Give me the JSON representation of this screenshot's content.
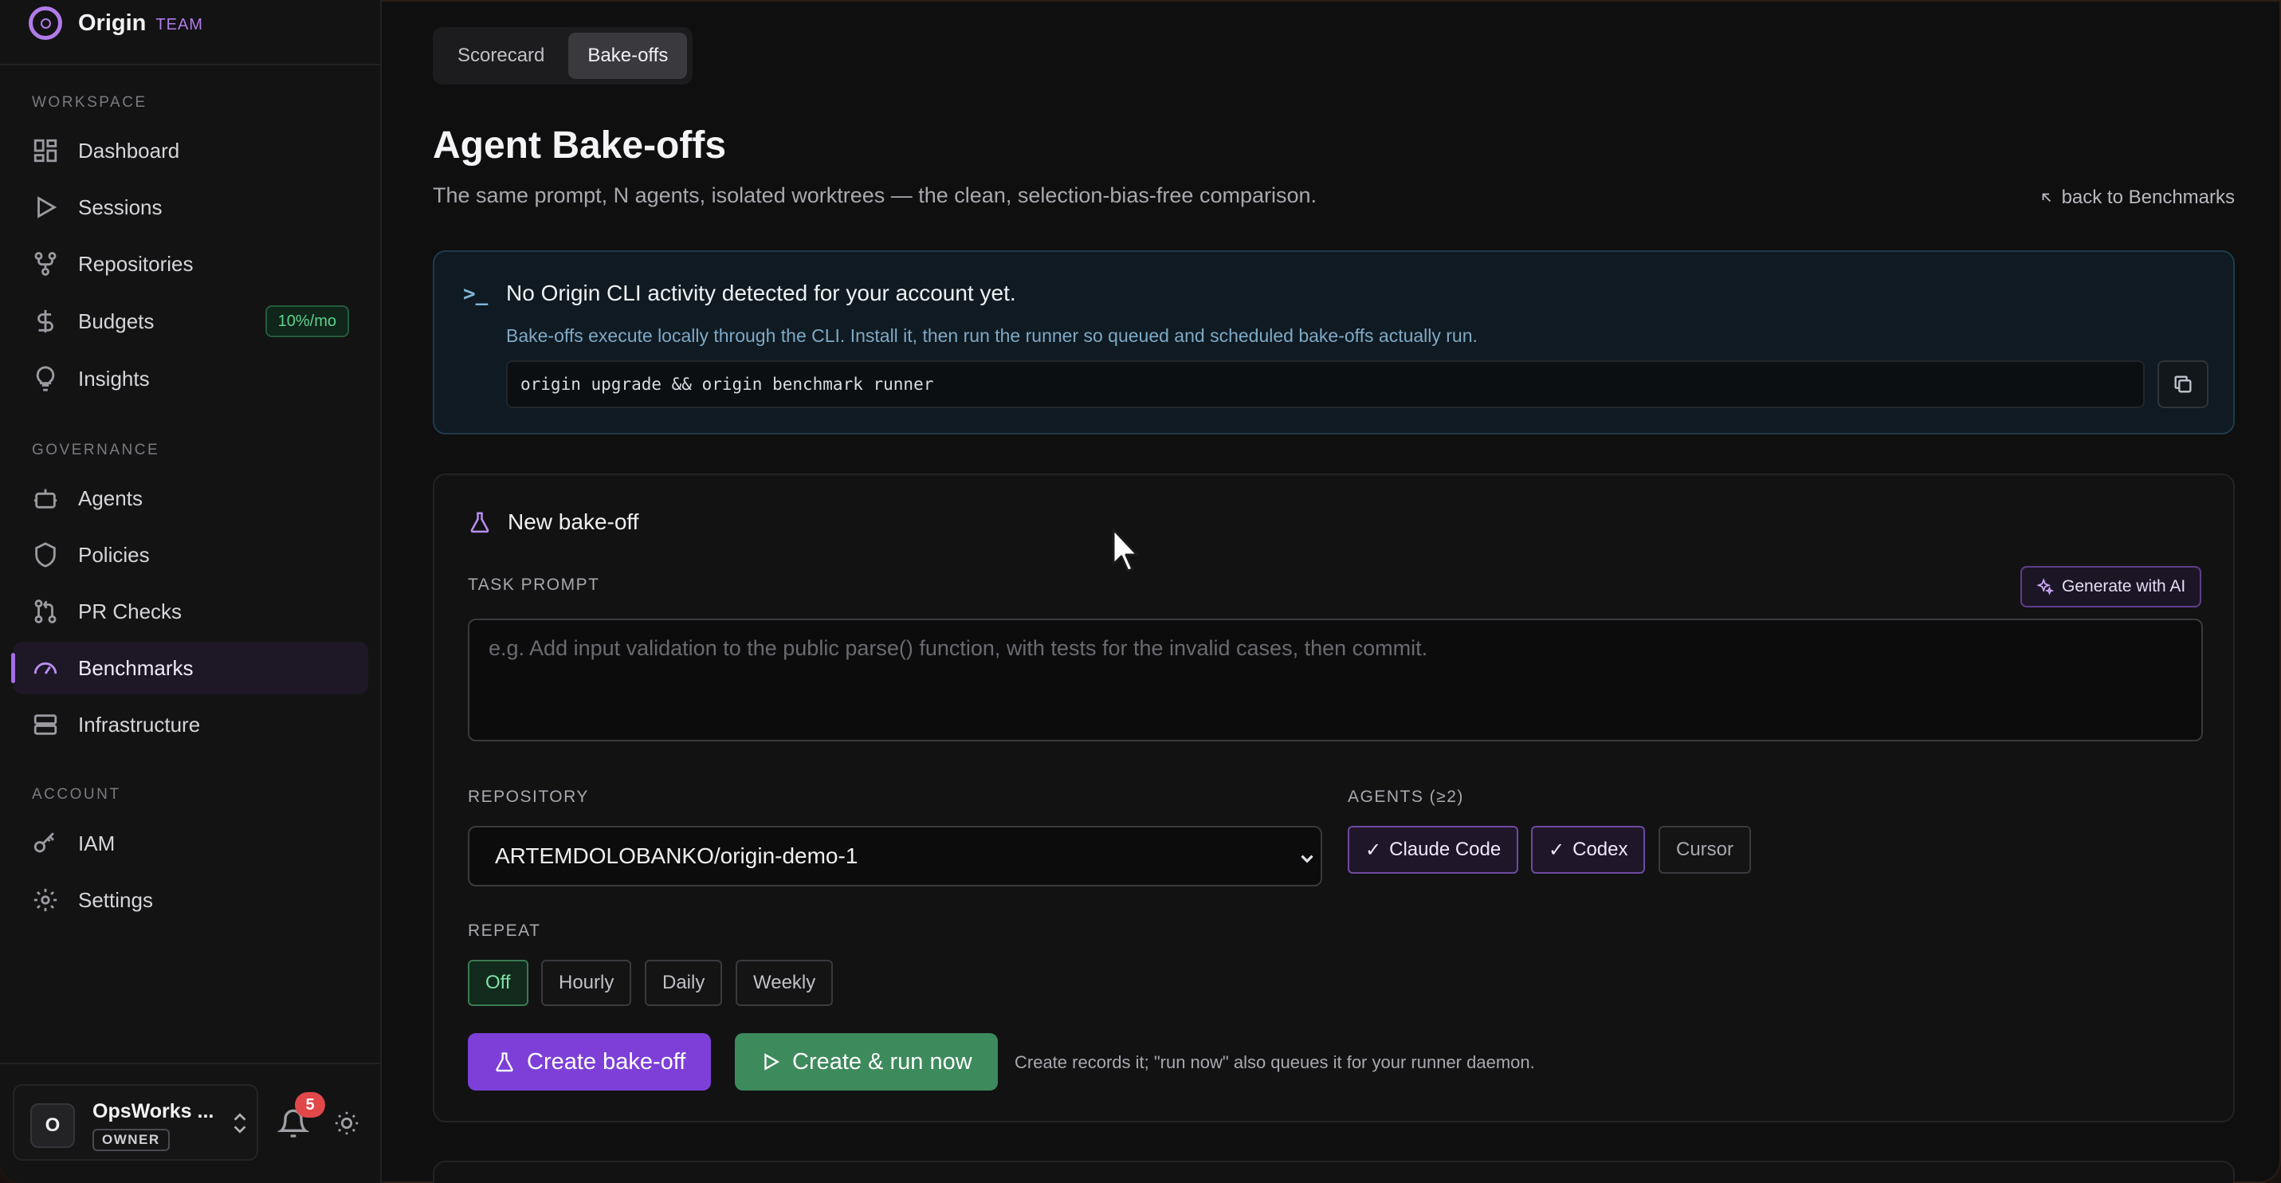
{
  "brand": {
    "name": "Origin",
    "tag": "TEAM"
  },
  "sidebar": {
    "sections": {
      "workspace": "WORKSPACE",
      "governance": "GOVERNANCE",
      "account": "ACCOUNT"
    },
    "items": [
      {
        "label": "Dashboard",
        "icon": "dashboard-icon"
      },
      {
        "label": "Sessions",
        "icon": "play-icon"
      },
      {
        "label": "Repositories",
        "icon": "git-branch-icon"
      },
      {
        "label": "Budgets",
        "icon": "dollar-icon",
        "badge": "10%/mo"
      },
      {
        "label": "Insights",
        "icon": "lightbulb-icon"
      },
      {
        "label": "Agents",
        "icon": "bot-icon"
      },
      {
        "label": "Policies",
        "icon": "shield-icon"
      },
      {
        "label": "PR Checks",
        "icon": "pull-request-icon"
      },
      {
        "label": "Benchmarks",
        "icon": "gauge-icon",
        "active": true
      },
      {
        "label": "Infrastructure",
        "icon": "server-icon"
      },
      {
        "label": "IAM",
        "icon": "key-icon"
      },
      {
        "label": "Settings",
        "icon": "gear-icon"
      }
    ],
    "org": {
      "avatar": "O",
      "name": "OpsWorks ...",
      "role": "OWNER"
    },
    "notifications": "5"
  },
  "tabs": [
    {
      "label": "Scorecard",
      "active": false
    },
    {
      "label": "Bake-offs",
      "active": true
    }
  ],
  "page": {
    "title": "Agent Bake-offs",
    "subtitle": "The same prompt, N agents, isolated worktrees — the clean, selection-bias-free comparison.",
    "back_link": "back to Benchmarks"
  },
  "cli_notice": {
    "title": "No Origin CLI activity detected for your account yet.",
    "description": "Bake-offs execute locally through the CLI. Install it, then run the runner so queued and scheduled bake-offs actually run.",
    "command": "origin upgrade && origin benchmark runner"
  },
  "form": {
    "title": "New bake-off",
    "task_prompt_label": "TASK PROMPT",
    "generate_ai_label": "Generate with AI",
    "prompt_placeholder": "e.g. Add input validation to the public parse() function, with tests for the invalid cases, then commit.",
    "repository_label": "REPOSITORY",
    "repository_value": "ARTEMDOLOBANKO/origin-demo-1",
    "agents_label": "AGENTS (≥2)",
    "agents": [
      {
        "label": "Claude Code",
        "selected": true
      },
      {
        "label": "Codex",
        "selected": true
      },
      {
        "label": "Cursor",
        "selected": false
      }
    ],
    "repeat_label": "REPEAT",
    "repeat_options": [
      {
        "label": "Off",
        "selected": true
      },
      {
        "label": "Hourly",
        "selected": false
      },
      {
        "label": "Daily",
        "selected": false
      },
      {
        "label": "Weekly",
        "selected": false
      }
    ],
    "create_label": "Create bake-off",
    "create_run_label": "Create & run now",
    "note": "Create records it; \"run now\" also queues it for your runner daemon."
  },
  "colors": {
    "accent_purple": "#7d3fd8",
    "accent_green": "#3d8a5c",
    "budget_badge": "#5fd28e",
    "notification_badge": "#e0484a"
  }
}
